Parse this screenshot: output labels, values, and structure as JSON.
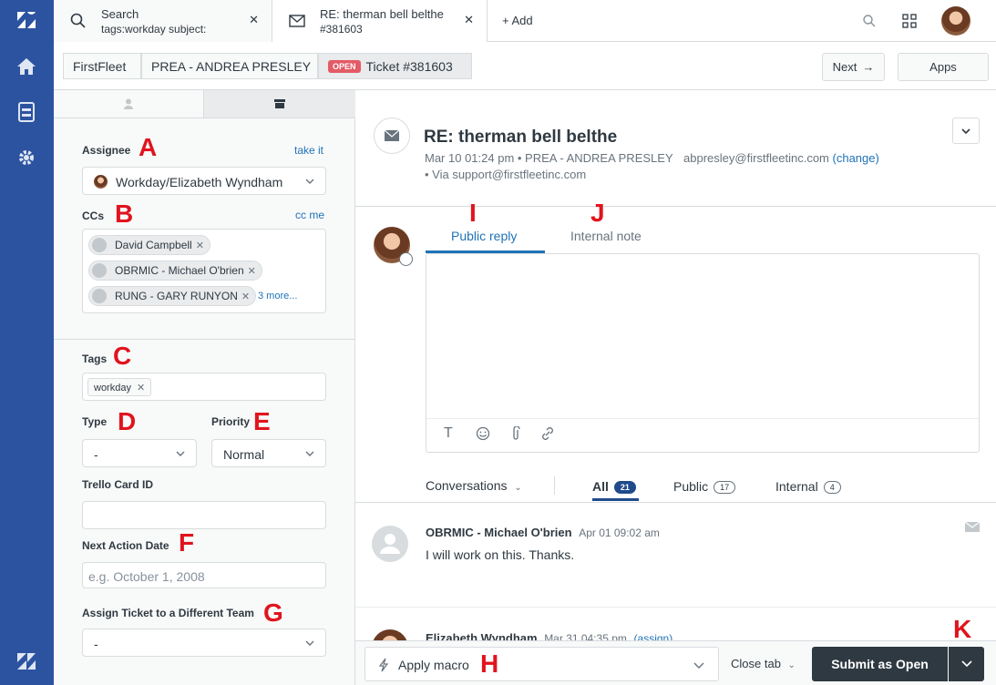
{
  "tabs": [
    {
      "title": "Search",
      "subtitle": "tags:workday subject:",
      "icon": "search-icon"
    },
    {
      "title": "RE: therman bell belthe",
      "subtitle": "#381603",
      "icon": "mail-icon"
    }
  ],
  "add_tab_label": "+ Add",
  "breadcrumb": {
    "org": "FirstFleet",
    "requester": "PREA - ANDREA PRESLEY",
    "status_badge": "OPEN",
    "ticket": "Ticket #381603"
  },
  "next_label": "Next",
  "apps_label": "Apps",
  "fields": {
    "assignee_label": "Assignee",
    "take_it": "take it",
    "assignee_value": "Workday/Elizabeth Wyndham",
    "ccs_label": "CCs",
    "cc_me": "cc me",
    "ccs": [
      "David Campbell",
      "OBRMIC - Michael O'brien",
      "RUNG - GARY RUNYON"
    ],
    "ccs_more": "3 more...",
    "tags_label": "Tags",
    "tags": [
      "workday"
    ],
    "type_label": "Type",
    "type_value": "-",
    "priority_label": "Priority",
    "priority_value": "Normal",
    "trello_label": "Trello Card ID",
    "trello_value": "",
    "next_action_label": "Next Action Date",
    "next_action_placeholder": "e.g. October 1, 2008",
    "assign_team_label": "Assign Ticket to a Different Team",
    "assign_team_value": "-"
  },
  "ticket": {
    "subject": "RE: therman bell belthe",
    "meta_line1": "Mar 10 01:24 pm • PREA - ANDREA PRESLEY",
    "email": "abpresley@firstfleetinc.com",
    "change": "(change)",
    "meta_line2": "• Via support@firstfleetinc.com"
  },
  "composer": {
    "public_reply": "Public reply",
    "internal_note": "Internal note"
  },
  "filters": {
    "conversations": "Conversations",
    "all": "All",
    "all_count": "21",
    "public": "Public",
    "public_count": "17",
    "internal": "Internal",
    "internal_count": "4"
  },
  "messages": [
    {
      "author": "OBRMIC - Michael O'brien",
      "time": "Apr 01 09:02 am",
      "body": "I will work on this. Thanks."
    },
    {
      "author": "Elizabeth Wyndham",
      "time": "Mar 31 04:35 pm",
      "extra": "(assign)"
    }
  ],
  "bottom": {
    "apply_macro": "Apply macro",
    "close_tab": "Close tab",
    "submit": "Submit as Open"
  },
  "annotations": [
    "A",
    "B",
    "C",
    "D",
    "E",
    "F",
    "G",
    "H",
    "I",
    "J",
    "K"
  ],
  "colors": {
    "rail": "#2c53a0",
    "link": "#1f73b7",
    "submit": "#2f3941",
    "annotation": "#e0141e",
    "open_badge": "#e35b66"
  }
}
